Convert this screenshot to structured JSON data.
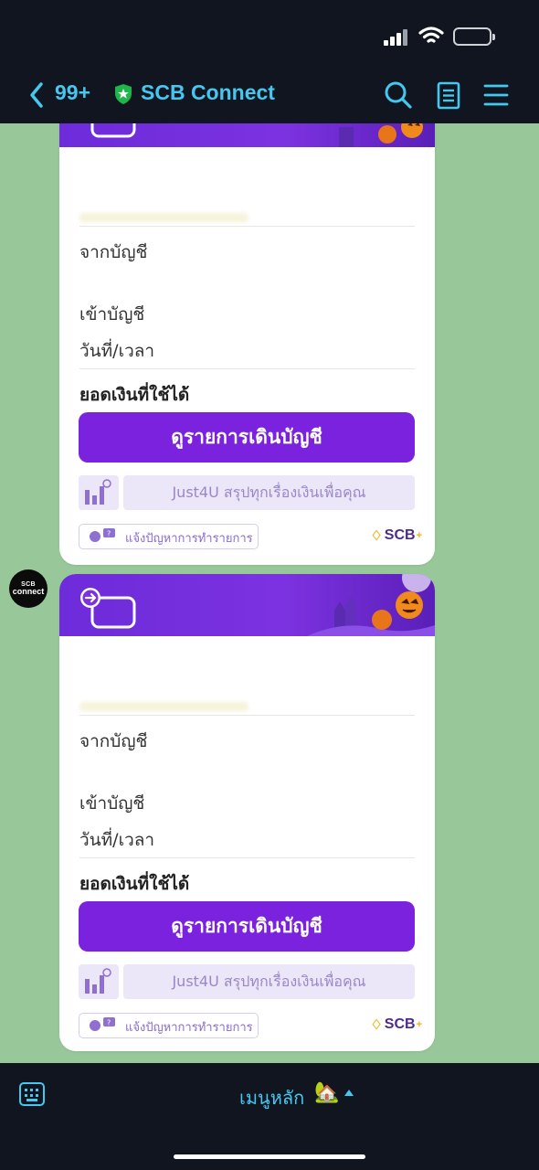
{
  "header": {
    "unread_count": "99+",
    "title": "SCB Connect"
  },
  "cards": [
    {
      "from_account_label": "จากบัญชี",
      "to_account_label": "เข้าบัญชี",
      "datetime_label": "วันที่/เวลา",
      "available_balance_label": "ยอดเงินที่ใช้ได้",
      "view_statement_button": "ดูรายการเดินบัญชี",
      "promo_text": "Just4U สรุปทุกเรื่องเงินเพื่อคุณ",
      "report_issue_label": "แจ้งปัญหาการทำรายการ",
      "brand_logo": "SCB"
    },
    {
      "from_account_label": "จากบัญชี",
      "to_account_label": "เข้าบัญชี",
      "datetime_label": "วันที่/เวลา",
      "available_balance_label": "ยอดเงินที่ใช้ได้",
      "view_statement_button": "ดูรายการเดินบัญชี",
      "promo_text": "Just4U สรุปทุกเรื่องเงินเพื่อคุณ",
      "report_issue_label": "แจ้งปัญหาการทำรายการ",
      "brand_logo": "SCB"
    }
  ],
  "avatar": {
    "line1": "SCB",
    "line2": "connect"
  },
  "bottom_bar": {
    "menu_label": "เมนูหลัก",
    "menu_icon": "🏡"
  },
  "colors": {
    "accent": "#45c8f0",
    "brand_purple": "#7a22de",
    "chat_background": "#98c89a",
    "bar_background": "#10151f"
  }
}
